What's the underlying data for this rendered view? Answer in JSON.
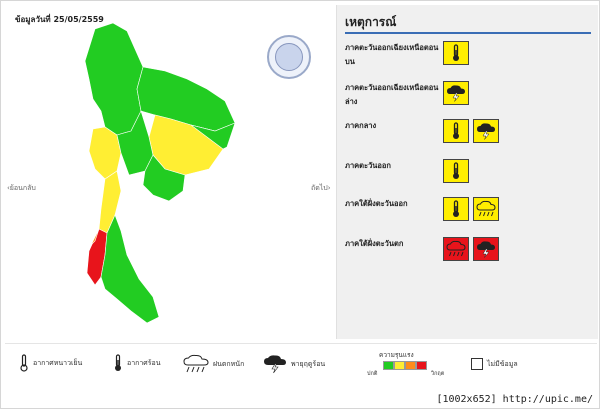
{
  "map": {
    "date_label": "ข้อมูลวันที่ 25/05/2559",
    "prev_label": "‹ย้อนกลับ",
    "next_label": "ถัดไป›",
    "colors": {
      "normal": "#22cc22",
      "watch": "#ffee33",
      "warning": "#ff8c1a",
      "severe": "#e8141b"
    }
  },
  "events": {
    "title": "เหตุการณ์",
    "regions": [
      {
        "label": "ภาคตะวันออกเฉียงเหนือตอนบน",
        "icons": [
          {
            "type": "thermometer-icon",
            "color": "yellow"
          }
        ]
      },
      {
        "label": "ภาคตะวันออกเฉียงเหนือตอนล่าง",
        "icons": [
          {
            "type": "thunderstorm-icon",
            "color": "yellow"
          }
        ]
      },
      {
        "label": "ภาคกลาง",
        "icons": [
          {
            "type": "thermometer-icon",
            "color": "yellow"
          },
          {
            "type": "thunderstorm-icon",
            "color": "yellow"
          }
        ]
      },
      {
        "label": "ภาคตะวันออก",
        "icons": [
          {
            "type": "thermometer-icon",
            "color": "yellow"
          }
        ]
      },
      {
        "label": "ภาคใต้ฝั่งตะวันออก",
        "icons": [
          {
            "type": "thermometer-icon",
            "color": "yellow"
          },
          {
            "type": "rain-icon",
            "color": "yellow"
          }
        ]
      },
      {
        "label": "ภาคใต้ฝั่งตะวันตก",
        "icons": [
          {
            "type": "rain-icon",
            "color": "red"
          },
          {
            "type": "thunderstorm-icon",
            "color": "red"
          }
        ]
      }
    ]
  },
  "legend": {
    "cold": "อากาศหนาวเย็น",
    "hot": "อากาศร้อน",
    "rain": "ฝนตกหนัก",
    "storm": "พายุฤดูร้อน",
    "severity_title": "ความรุนแรง",
    "severity_low": "ปกติ",
    "severity_high": "วิกฤต",
    "severity_colors": [
      "#22cc22",
      "#ffee33",
      "#ff8c1a",
      "#e8141b"
    ],
    "no_data": "ไม่มีข้อมูล"
  },
  "watermark": "[1002x652] http://upic.me/"
}
